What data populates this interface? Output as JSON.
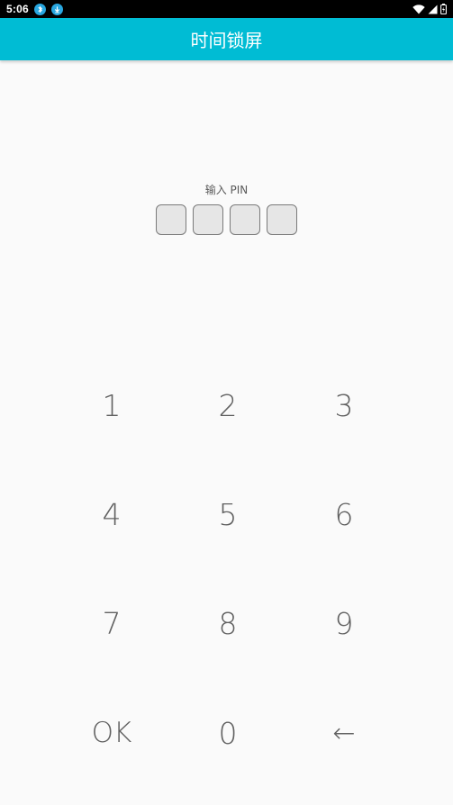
{
  "status_bar": {
    "time": "5:06",
    "notification_icons": [
      "bluetooth-icon",
      "download-icon"
    ],
    "right_icons": [
      "wifi-icon",
      "signal-icon",
      "battery-icon"
    ]
  },
  "app_bar": {
    "title": "时间锁屏"
  },
  "pin": {
    "label": "输入 PIN",
    "length": 4
  },
  "keypad": {
    "keys": [
      {
        "label": "1"
      },
      {
        "label": "2"
      },
      {
        "label": "3"
      },
      {
        "label": "4"
      },
      {
        "label": "5"
      },
      {
        "label": "6"
      },
      {
        "label": "7"
      },
      {
        "label": "8"
      },
      {
        "label": "9"
      },
      {
        "label": "OK"
      },
      {
        "label": "0"
      },
      {
        "label": "←"
      }
    ]
  },
  "colors": {
    "app_bar": "#00bcd4",
    "background": "#fafafa",
    "key_text": "#616161",
    "status_bar": "#000000"
  }
}
